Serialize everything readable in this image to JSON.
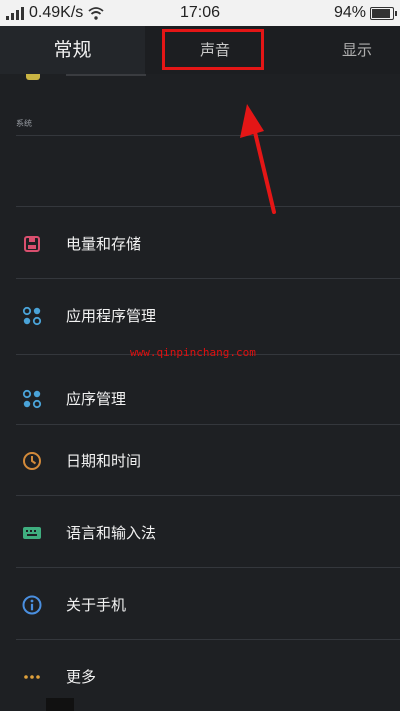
{
  "status_bar": {
    "speed": "0.49K/s",
    "time": "17:06",
    "battery": "94%",
    "icons": [
      "signal-icon",
      "wifi-icon",
      "battery-icon"
    ]
  },
  "tabs": {
    "general": "常规",
    "sound": "声音",
    "display": "显示"
  },
  "section": {
    "system_label": "系统"
  },
  "items": [
    {
      "label": "电量和存储",
      "icon": "battery-storage-icon",
      "color": "#d94f6e"
    },
    {
      "label": "应用程序管理",
      "icon": "apps-icon",
      "color": "#4aa3d8"
    },
    {
      "label": "应序管理",
      "icon": "apps-icon",
      "color": "#4aa3d8"
    },
    {
      "label": "日期和时间",
      "icon": "clock-icon",
      "color": "#d38a3a"
    },
    {
      "label": "语言和输入法",
      "icon": "keyboard-icon",
      "color": "#3fae7f"
    },
    {
      "label": "关于手机",
      "icon": "info-icon",
      "color": "#4a8fe0"
    },
    {
      "label": "更多",
      "icon": "more-icon",
      "color": "#e0a13c"
    }
  ],
  "watermark": "www.qinpinchang.com",
  "colors": {
    "background": "#1e2023",
    "highlight": "#e41616"
  }
}
